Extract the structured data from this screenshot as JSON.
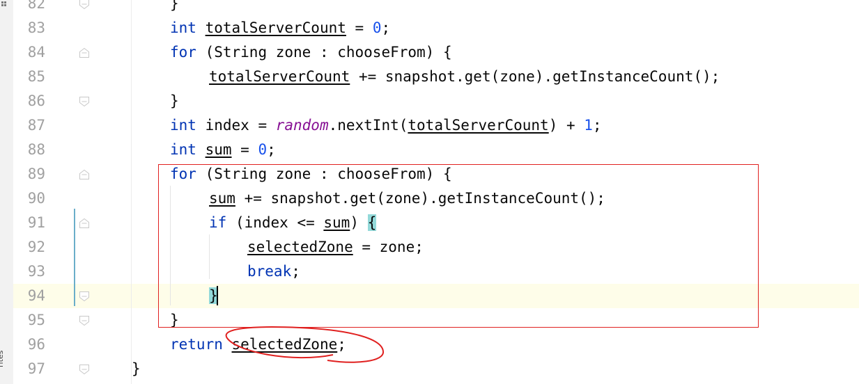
{
  "editor": {
    "side_panel_label": "rites",
    "lines": [
      {
        "num": "82",
        "text": "}"
      },
      {
        "num": "83",
        "text": "int totalServerCount = 0;"
      },
      {
        "num": "84",
        "text": "for (String zone : chooseFrom) {"
      },
      {
        "num": "85",
        "text": "totalServerCount += snapshot.get(zone).getInstanceCount();"
      },
      {
        "num": "86",
        "text": "}"
      },
      {
        "num": "87",
        "text": "int index = random.nextInt(totalServerCount) + 1;"
      },
      {
        "num": "88",
        "text": "int sum = 0;"
      },
      {
        "num": "89",
        "text": "for (String zone : chooseFrom) {"
      },
      {
        "num": "90",
        "text": "sum += snapshot.get(zone).getInstanceCount();"
      },
      {
        "num": "91",
        "text": "if (index <= sum) {"
      },
      {
        "num": "92",
        "text": "selectedZone = zone;"
      },
      {
        "num": "93",
        "text": "break;"
      },
      {
        "num": "94",
        "text": "}"
      },
      {
        "num": "95",
        "text": "}"
      },
      {
        "num": "96",
        "text": "return selectedZone;"
      },
      {
        "num": "97",
        "text": "}"
      }
    ],
    "colors": {
      "keyword": "#0033b3",
      "number": "#1750eb",
      "field": "#871094",
      "caret_line": "#fefde9",
      "brace_match": "#93d9d9",
      "annotation": "#e0201f"
    }
  }
}
